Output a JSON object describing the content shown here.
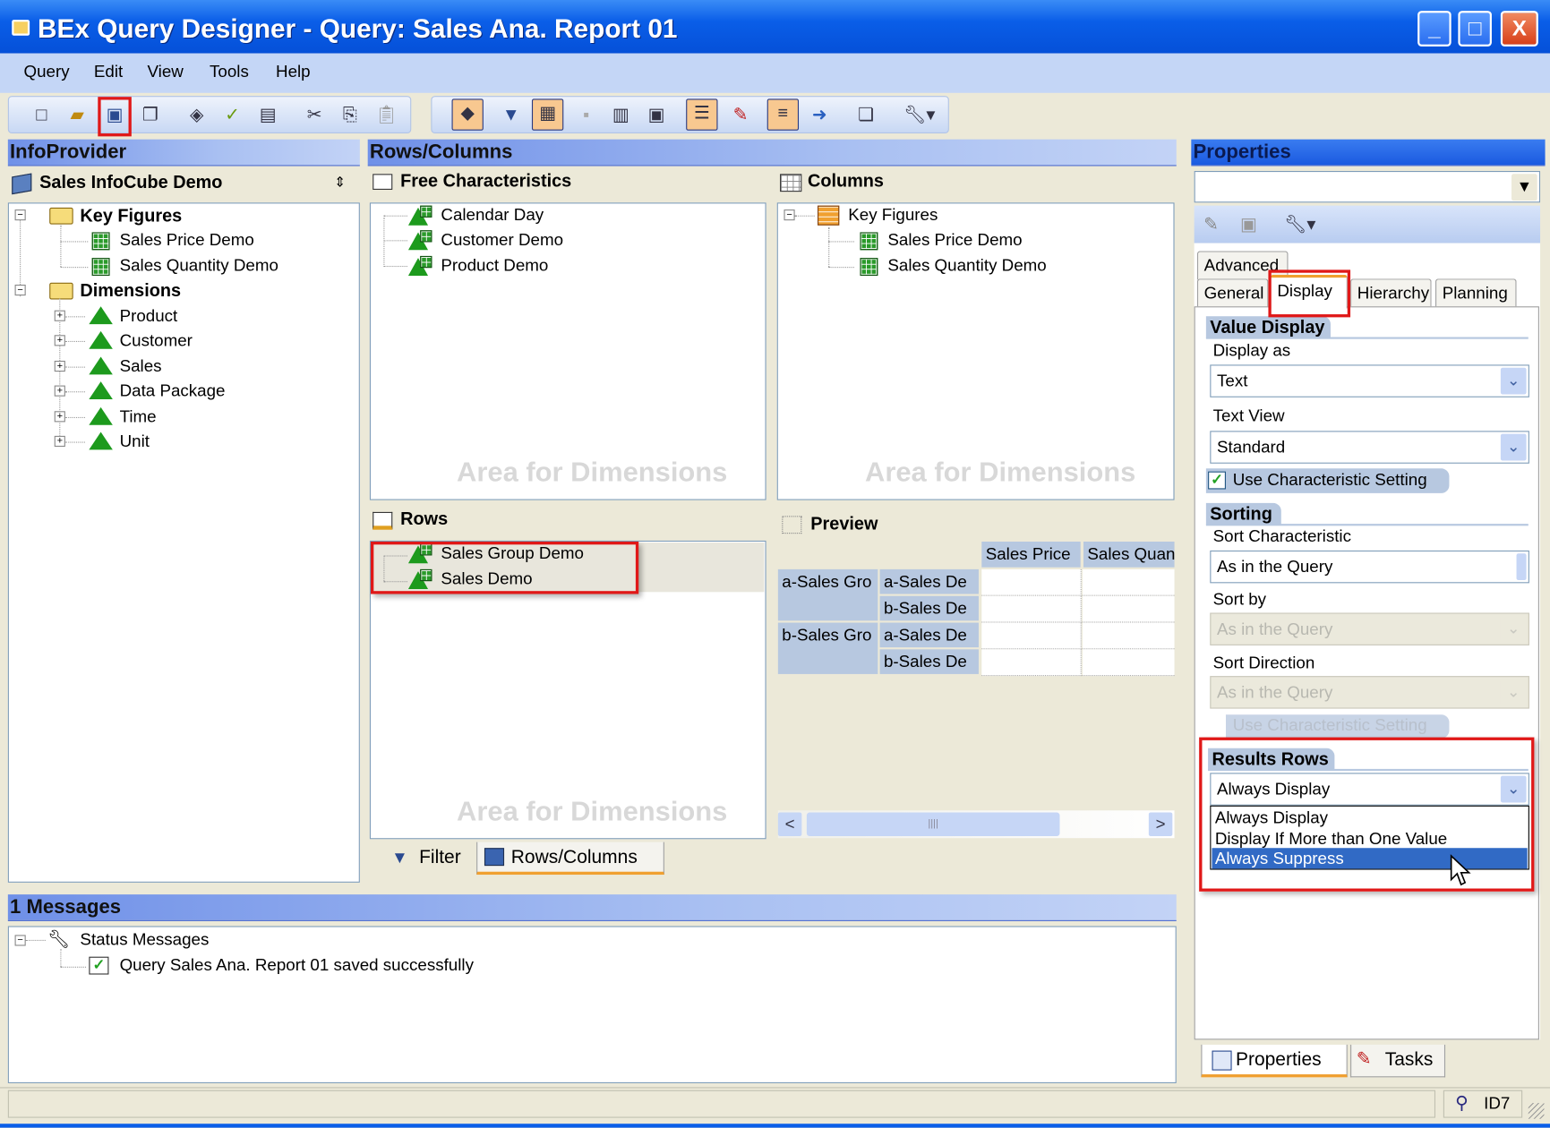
{
  "window": {
    "title": "BEx Query Designer - Query: Sales Ana. Report 01",
    "min": "_",
    "max": "□",
    "close": "X"
  },
  "menu": [
    "Query",
    "Edit",
    "View",
    "Tools",
    "Help"
  ],
  "infoprovider": {
    "header": "InfoProvider",
    "provider": "Sales InfoCube Demo",
    "key_figures_label": "Key Figures",
    "key_figures": [
      "Sales Price Demo",
      "Sales Quantity Demo"
    ],
    "dimensions_label": "Dimensions",
    "dimensions": [
      "Product",
      "Customer",
      "Sales",
      "Data Package",
      "Time",
      "Unit"
    ]
  },
  "rows_columns": {
    "header": "Rows/Columns",
    "free": {
      "label": "Free Characteristics",
      "items": [
        "Calendar Day",
        "Customer Demo",
        "Product Demo"
      ],
      "watermark": "Area for Dimensions"
    },
    "columns": {
      "label": "Columns",
      "key_figures_label": "Key Figures",
      "items": [
        "Sales Price Demo",
        "Sales Quantity Demo"
      ],
      "watermark": "Area for Dimensions"
    },
    "rows": {
      "label": "Rows",
      "items": [
        "Sales Group Demo",
        "Sales Demo"
      ],
      "watermark": "Area for Dimensions"
    },
    "preview": {
      "label": "Preview",
      "headers": [
        "Sales Price",
        "Sales Quan"
      ],
      "rows": [
        [
          "a-Sales Gro",
          "a-Sales De"
        ],
        [
          "",
          "b-Sales De"
        ],
        [
          "b-Sales Gro",
          "a-Sales De"
        ],
        [
          "",
          "b-Sales De"
        ]
      ]
    },
    "tabs": [
      "Filter",
      "Rows/Columns"
    ],
    "active_tab": "Rows/Columns"
  },
  "properties": {
    "header": "Properties",
    "selector_value": "",
    "tabs_row1": [
      "Advanced"
    ],
    "tabs_row2": [
      "General",
      "Display",
      "Hierarchy",
      "Planning"
    ],
    "active_tab": "Display",
    "value_display": {
      "title": "Value Display",
      "display_as_label": "Display as",
      "display_as": "Text",
      "text_view_label": "Text View",
      "text_view": "Standard",
      "use_char_setting": "Use Characteristic Setting",
      "use_char_checked": true
    },
    "sorting": {
      "title": "Sorting",
      "sort_char_label": "Sort Characteristic",
      "sort_char": "As in the Query",
      "sort_by_label": "Sort by",
      "sort_by": "As in the Query",
      "sort_dir_label": "Sort Direction",
      "sort_dir": "As in the Query",
      "use_char_setting": "Use Characteristic Setting",
      "use_char_checked": false
    },
    "results_rows": {
      "title": "Results Rows",
      "value": "Always Display",
      "options": [
        "Always Display",
        "Display If More than One Value",
        "Always Suppress"
      ],
      "highlighted": "Always Suppress"
    },
    "bottom_tabs": [
      "Properties",
      "Tasks"
    ],
    "active_bottom_tab": "Properties"
  },
  "messages": {
    "header": "1 Messages",
    "group": "Status Messages",
    "items": [
      "Query Sales Ana. Report 01 saved successfully"
    ]
  },
  "statusbar": {
    "system": "ID7"
  },
  "colors": {
    "titlebar": "#0a5ee8",
    "highlight_box": "#e01818",
    "selection": "#316ac5",
    "panel_header": "#6f90e8"
  }
}
